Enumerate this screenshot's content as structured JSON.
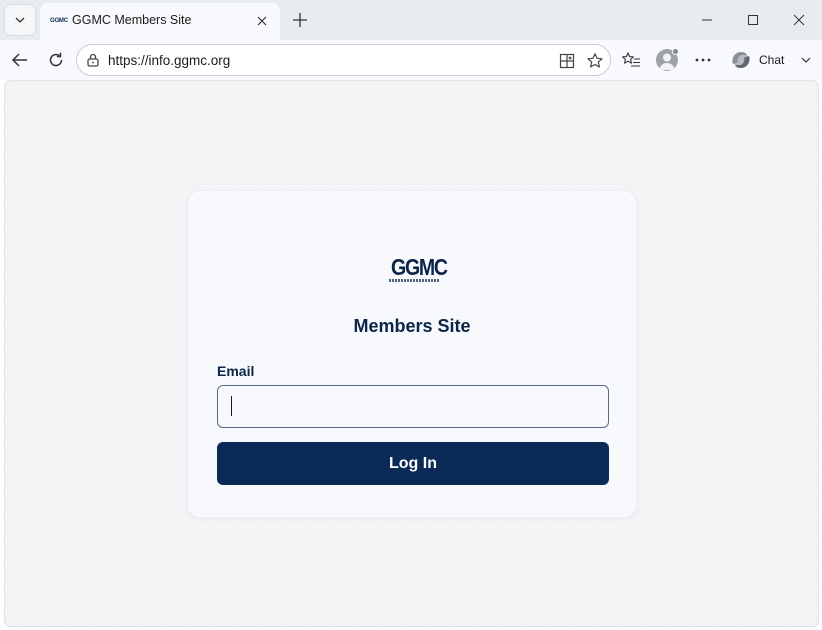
{
  "browser": {
    "tab": {
      "favicon_text": "GGMC",
      "title": "GGMC Members Site"
    },
    "address": {
      "url": "https://info.ggmc.org"
    },
    "chat_label": "Chat"
  },
  "page": {
    "logo_text": "GGMC",
    "title": "Members Site",
    "email_label": "Email",
    "email_value": "",
    "login_label": "Log In"
  },
  "colors": {
    "brand_navy": "#0b2a57",
    "chrome_bg": "#e8ebf0",
    "toolbar_bg": "#f7f9fc"
  }
}
